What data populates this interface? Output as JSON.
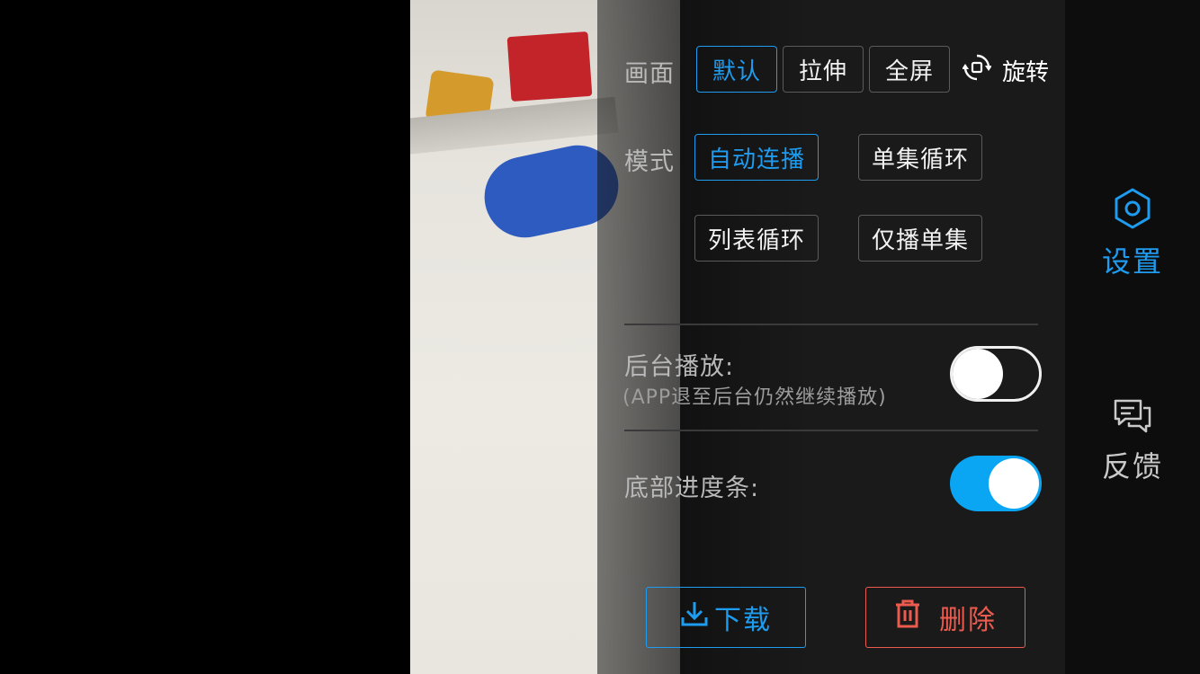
{
  "display": {
    "label": "画面",
    "options": [
      "默认",
      "拉伸",
      "全屏"
    ],
    "selected": "默认",
    "rotate_label": "旋转"
  },
  "mode": {
    "label": "模式",
    "options": [
      "自动连播",
      "单集循环",
      "列表循环",
      "仅播单集"
    ],
    "selected": "自动连播"
  },
  "background_play": {
    "label": "后台播放:",
    "hint": "(APP退至后台仍然继续播放)",
    "enabled": false
  },
  "bottom_progress": {
    "label": "底部进度条:",
    "enabled": true
  },
  "actions": {
    "download_label": "下载",
    "delete_label": "删除"
  },
  "sidebar": {
    "settings_label": "设置",
    "feedback_label": "反馈"
  },
  "colors": {
    "accent": "#1e9cf0",
    "toggle_on": "#0aa6f4",
    "danger": "#ec5b4e"
  }
}
